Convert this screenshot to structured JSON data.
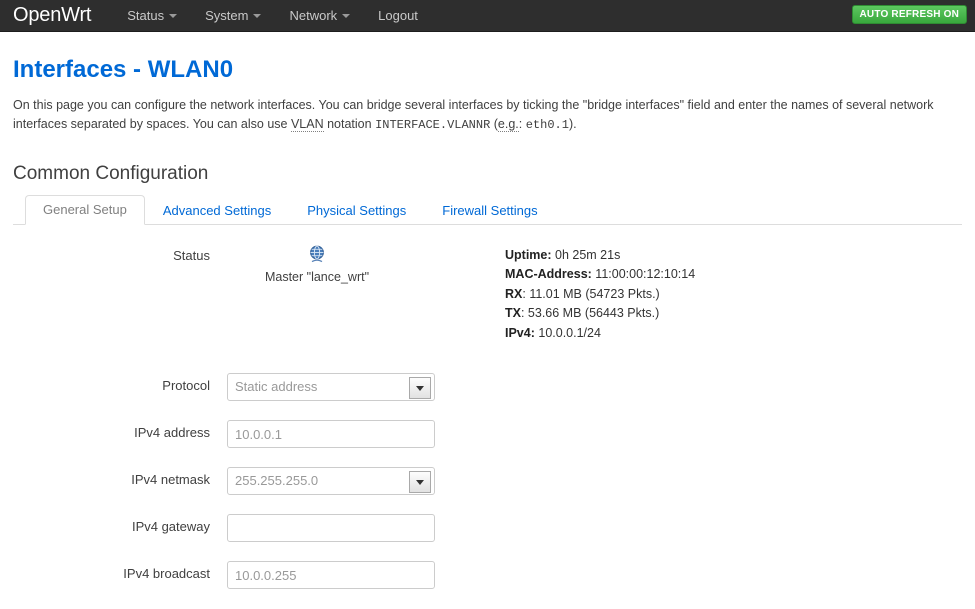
{
  "header": {
    "brand": "OpenWrt",
    "nav": [
      {
        "label": "Status",
        "has_caret": true
      },
      {
        "label": "System",
        "has_caret": true
      },
      {
        "label": "Network",
        "has_caret": true
      },
      {
        "label": "Logout",
        "has_caret": false
      }
    ],
    "refresh_badge": "AUTO REFRESH ON",
    "refresh_badge_color": "#4cb950"
  },
  "page": {
    "title": "Interfaces - WLAN0",
    "title_color": "#0069d6",
    "desc_part1": "On this page you can configure the network interfaces. You can bridge several interfaces by ticking the \"bridge interfaces\" field and enter the names of several network interfaces separated by spaces. You can also use ",
    "desc_vlan": "VLAN",
    "desc_part2": " notation ",
    "desc_mono1": "INTERFACE.VLANNR",
    "desc_part3": " (",
    "desc_eg": "e.g.",
    "desc_part4": ": ",
    "desc_mono2": "eth0.1",
    "desc_part5": ").",
    "section_title": "Common Configuration"
  },
  "tabs": [
    {
      "label": "General Setup",
      "active": true
    },
    {
      "label": "Advanced Settings",
      "active": false
    },
    {
      "label": "Physical Settings",
      "active": false
    },
    {
      "label": "Firewall Settings",
      "active": false
    }
  ],
  "status": {
    "label": "Status",
    "icon": "wireless-globe-icon",
    "interface_caption": "Master \"lance_wrt\"",
    "stats": [
      {
        "key": "Uptime:",
        "value": "0h 25m 21s"
      },
      {
        "key": "MAC-Address:",
        "value": "11:00:00:12:10:14"
      },
      {
        "key": "RX",
        "value": ": 11.01 MB (54723 Pkts.)"
      },
      {
        "key": "TX",
        "value": ": 53.66 MB (56443 Pkts.)"
      },
      {
        "key": "IPv4:",
        "value": "10.0.0.1/24"
      }
    ]
  },
  "form": {
    "protocol": {
      "label": "Protocol",
      "value": "Static address"
    },
    "ipv4_address": {
      "label": "IPv4 address",
      "value": "10.0.0.1"
    },
    "ipv4_netmask": {
      "label": "IPv4 netmask",
      "value": "255.255.255.0"
    },
    "ipv4_gateway": {
      "label": "IPv4 gateway",
      "value": ""
    },
    "ipv4_broadcast": {
      "label": "IPv4 broadcast",
      "value": "10.0.0.255"
    }
  }
}
